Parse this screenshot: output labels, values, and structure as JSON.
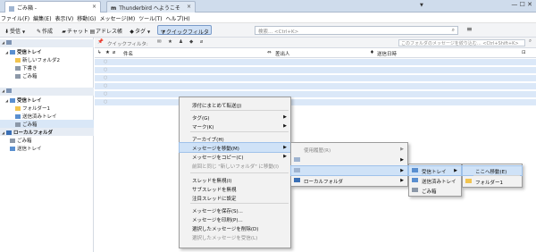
{
  "tabs": [
    {
      "label": "ごみ箱 -",
      "close": "×"
    },
    {
      "label": "Thunderbird へようこそ",
      "close": "×"
    }
  ],
  "tab_list_icon": "chevron-down-icon",
  "window_controls": "— ☐ ✕",
  "menubar": [
    "ファイル(F)",
    "編集(E)",
    "表示(V)",
    "移動(G)",
    "メッセージ(M)",
    "ツール(T)",
    "ヘルプ(H)"
  ],
  "toolbar": {
    "get": "受信",
    "write": "作成",
    "chat": "チャット",
    "addressbook": "アドレス帳",
    "tag": "タグ",
    "quickfilter": "クイックフィルタ",
    "search_placeholder": "検索... <Ctrl+K>"
  },
  "folders": [
    {
      "label": "",
      "bold": false
    },
    {
      "label": "受信トレイ",
      "bold": true
    },
    {
      "label": "新しいフォルダ2",
      "bold": false
    },
    {
      "label": "下書き",
      "bold": false
    },
    {
      "label": "ごみ箱",
      "bold": false
    },
    {
      "label": "",
      "bold": false
    },
    {
      "label": "受信トレイ",
      "bold": true
    },
    {
      "label": "フォルダー1",
      "bold": false
    },
    {
      "label": "送信済みトレイ",
      "bold": false
    },
    {
      "label": "ごみ箱",
      "bold": false
    },
    {
      "label": "ローカルフォルダ",
      "bold": true
    },
    {
      "label": "ごみ箱",
      "bold": false
    },
    {
      "label": "送信トレイ",
      "bold": false
    }
  ],
  "quickfilter_bar": {
    "label": "クイックフィルタ:",
    "search_placeholder": "このフォルダのメッセージを絞り込む... <Ctrl+Shift+K>"
  },
  "columns": {
    "subject": "件名",
    "from": "差出人",
    "date": "送信日時"
  },
  "context_menu": [
    {
      "label": "添付にまとめて転送(J)",
      "sub": false,
      "dis": false
    },
    {
      "label": "タグ(G)",
      "sub": true,
      "dis": false
    },
    {
      "label": "マーク(K)",
      "sub": true,
      "dis": false
    },
    {
      "label": "アーカイブ(H)",
      "sub": false,
      "dis": false
    },
    {
      "label": "メッセージを移動(M)",
      "sub": true,
      "dis": false
    },
    {
      "label": "メッセージをコピー(C)",
      "sub": true,
      "dis": false
    },
    {
      "label": "前回と同じ \"新しいフォルダ\" に移動(I)",
      "sub": false,
      "dis": true
    },
    {
      "label": "スレッドを無視(I)",
      "sub": false,
      "dis": false
    },
    {
      "label": "サブスレッドを無視",
      "sub": false,
      "dis": false
    },
    {
      "label": "注目スレッドに設定",
      "sub": false,
      "dis": false
    },
    {
      "label": "メッセージを保存(S)...",
      "sub": false,
      "dis": false
    },
    {
      "label": "メッセージを印刷(P)...",
      "sub": false,
      "dis": false
    },
    {
      "label": "選択したメッセージを削除(D)",
      "sub": false,
      "dis": false
    },
    {
      "label": "選択したメッセージを受信(L)",
      "sub": false,
      "dis": true
    }
  ],
  "move_menu": [
    {
      "label": "使用履歴(R)",
      "dis": true
    },
    {
      "label": "",
      "dis": false
    },
    {
      "label": "",
      "dis": false
    },
    {
      "label": "ローカルフォルダ",
      "dis": false
    }
  ],
  "account_menu": [
    {
      "label": "受信トレイ"
    },
    {
      "label": "送信済みトレイ"
    },
    {
      "label": "ごみ箱"
    }
  ],
  "inbox_menu": [
    {
      "label": "ここへ移動(E)"
    },
    {
      "label": "フォルダー1"
    }
  ],
  "colors": {
    "accent": "#cfe2f7",
    "selection": "#dbe8f8",
    "folder": "#f2c44f"
  }
}
